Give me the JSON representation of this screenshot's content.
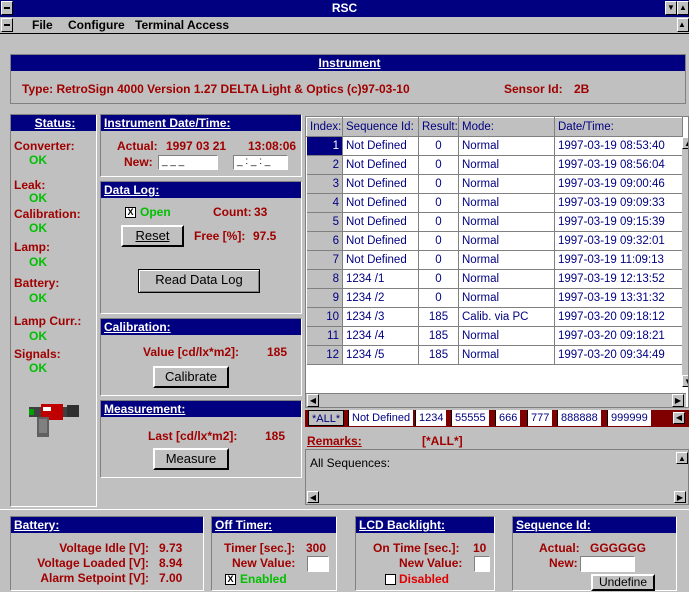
{
  "window": {
    "title": "RSC"
  },
  "menu": {
    "file": "File",
    "configure": "Configure",
    "terminal": "Terminal Access"
  },
  "instrument": {
    "header": "Instrument",
    "type_text": "Type: RetroSign 4000 Version 1.27 DELTA Light & Optics (c)97-03-10",
    "sensor_label": "Sensor Id:",
    "sensor_value": "2B"
  },
  "status": {
    "header": "Status:",
    "items": [
      {
        "label": "Converter:",
        "value": "OK"
      },
      {
        "label": "Leak:",
        "value": "OK"
      },
      {
        "label": "Calibration:",
        "value": "OK"
      },
      {
        "label": "Lamp:",
        "value": "OK"
      },
      {
        "label": "Battery:",
        "value": "OK"
      },
      {
        "label": "Lamp Curr.:",
        "value": "OK"
      },
      {
        "label": "Signals:",
        "value": "OK"
      }
    ]
  },
  "datetime": {
    "header": "Instrument Date/Time:",
    "actual_label": "Actual:",
    "actual_date": "1997 03 21",
    "actual_time": "13:08:06",
    "new_label": "New:",
    "date_sep": "_ _ _",
    "time_sep": "_ : _ : _"
  },
  "datalog": {
    "header": "Data Log:",
    "open_label": "Open",
    "open_check": "X",
    "count_label": "Count:",
    "count_value": "33",
    "reset": "Reset",
    "free_label": "Free [%]:",
    "free_value": "97.5",
    "read": "Read Data Log"
  },
  "calibration": {
    "header": "Calibration:",
    "value_label": "Value [cd/lx*m2]:",
    "value": "185",
    "button": "Calibrate"
  },
  "measurement": {
    "header": "Measurement:",
    "last_label": "Last [cd/lx*m2]:",
    "value": "185",
    "button": "Measure"
  },
  "table": {
    "columns": [
      "Index:",
      "Sequence Id:",
      "Result:",
      "Mode:",
      "Date/Time:"
    ],
    "rows": [
      [
        "1",
        "Not Defined",
        "0",
        "Normal",
        "1997-03-19 08:53:40"
      ],
      [
        "2",
        "Not Defined",
        "0",
        "Normal",
        "1997-03-19 08:56:04"
      ],
      [
        "3",
        "Not Defined",
        "0",
        "Normal",
        "1997-03-19 09:00:46"
      ],
      [
        "4",
        "Not Defined",
        "0",
        "Normal",
        "1997-03-19 09:09:33"
      ],
      [
        "5",
        "Not Defined",
        "0",
        "Normal",
        "1997-03-19 09:15:39"
      ],
      [
        "6",
        "Not Defined",
        "0",
        "Normal",
        "1997-03-19 09:32:01"
      ],
      [
        "7",
        "Not Defined",
        "0",
        "Normal",
        "1997-03-19 11:09:13"
      ],
      [
        "8",
        "1234 /1",
        "0",
        "Normal",
        "1997-03-19 12:13:52"
      ],
      [
        "9",
        "1234 /2",
        "0",
        "Normal",
        "1997-03-19 13:31:32"
      ],
      [
        "10",
        "1234 /3",
        "185",
        "Calib. via PC",
        "1997-03-20 09:18:12"
      ],
      [
        "11",
        "1234 /4",
        "185",
        "Normal",
        "1997-03-20 09:18:21"
      ],
      [
        "12",
        "1234 /5",
        "185",
        "Normal",
        "1997-03-20 09:34:49"
      ]
    ]
  },
  "tabs": [
    "*ALL*",
    "Not Defined",
    "1234",
    "55555",
    "666",
    "777",
    "888888",
    "999999"
  ],
  "remarks": {
    "label": "Remarks:",
    "filter": "[*ALL*]",
    "text": "All Sequences:"
  },
  "battery": {
    "header": "Battery:",
    "idle_label": "Voltage Idle [V]:",
    "idle": "9.73",
    "loaded_label": "Voltage Loaded [V]:",
    "loaded": "8.94",
    "alarm_label": "Alarm Setpoint [V]:",
    "alarm": "7.00"
  },
  "offtimer": {
    "header": "Off Timer:",
    "timer_label": "Timer [sec.]:",
    "timer": "300",
    "new_label": "New Value:",
    "enabled_check": "X",
    "enabled": "Enabled"
  },
  "lcd": {
    "header": "LCD Backlight:",
    "on_label": "On Time [sec.]:",
    "on": "10",
    "new_label": "New Value:",
    "disabled": "Disabled"
  },
  "sequence": {
    "header": "Sequence Id:",
    "actual_label": "Actual:",
    "actual": "GGGGGG",
    "new_label": "New:",
    "button": "Undefine"
  },
  "colors": {
    "title_bg": "#000080",
    "label_red": "#a00000",
    "ok_green": "#00c000",
    "tab_strip": "#800000"
  }
}
